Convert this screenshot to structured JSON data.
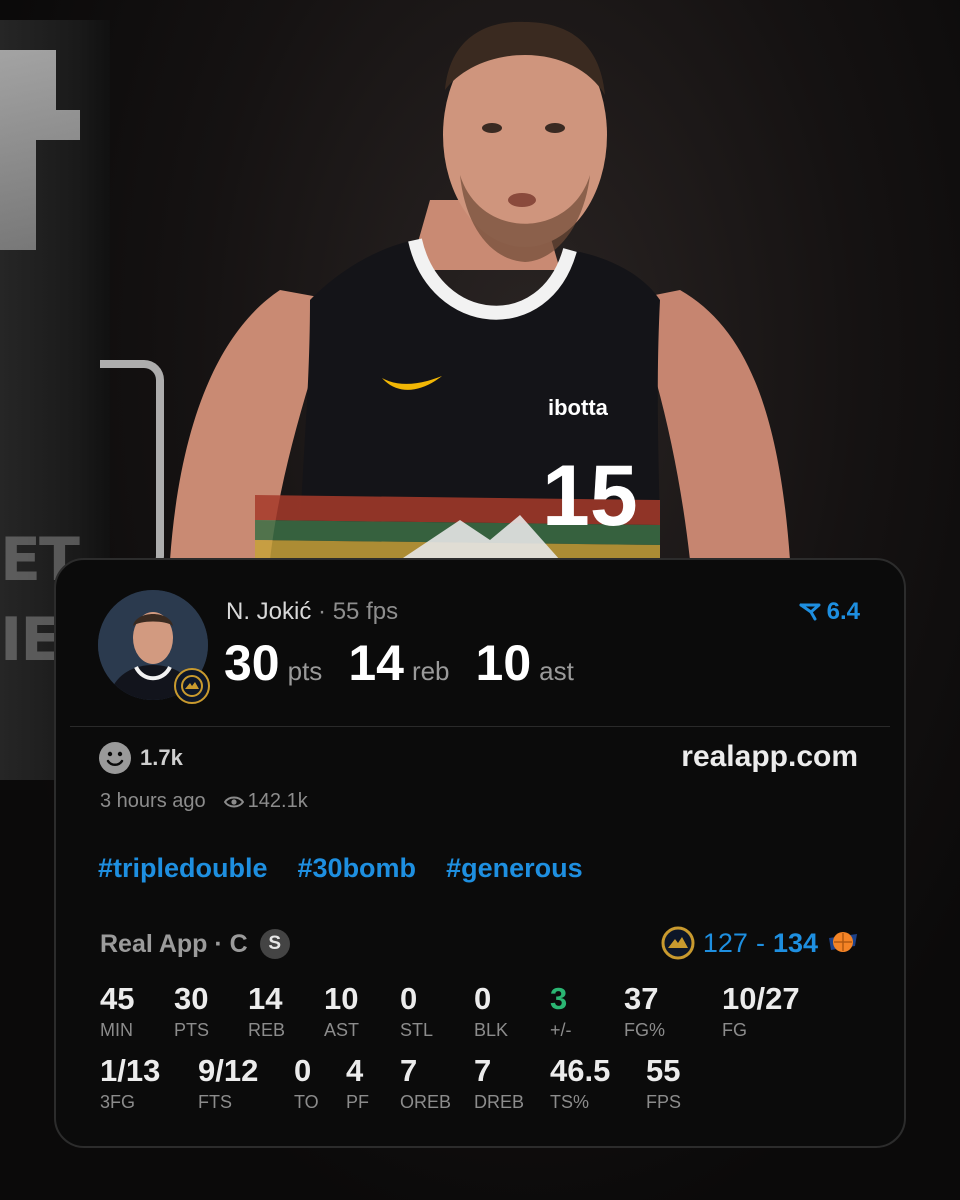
{
  "player": {
    "name": "N. Jokić",
    "separator": "·",
    "fps": "55 fps",
    "rating": "6.4",
    "headline": [
      {
        "value": "30",
        "unit": "pts"
      },
      {
        "value": "14",
        "unit": "reb"
      },
      {
        "value": "10",
        "unit": "ast"
      }
    ],
    "jersey_brand": "ibotta",
    "jersey_number": "15"
  },
  "post": {
    "reactions": "1.7k",
    "site": "realapp.com",
    "time_ago": "3 hours ago",
    "views": "142.1k",
    "tags": [
      "#tripledouble",
      "#30bomb",
      "#generous"
    ]
  },
  "game": {
    "source": "Real App · C",
    "source_badge": "S",
    "score_home": "127",
    "score_dash": "-",
    "score_away": "134"
  },
  "stats_row1": [
    {
      "value": "45",
      "label": "MIN"
    },
    {
      "value": "30",
      "label": "PTS"
    },
    {
      "value": "14",
      "label": "REB"
    },
    {
      "value": "10",
      "label": "AST"
    },
    {
      "value": "0",
      "label": "STL"
    },
    {
      "value": "0",
      "label": "BLK"
    },
    {
      "value": "3",
      "label": "+/-"
    },
    {
      "value": "37",
      "label": "FG%"
    },
    {
      "value": "10/27",
      "label": "FG"
    }
  ],
  "stats_row2": [
    {
      "value": "1/13",
      "label": "3FG"
    },
    {
      "value": "9/12",
      "label": "FTS"
    },
    {
      "value": "0",
      "label": "TO"
    },
    {
      "value": "4",
      "label": "PF"
    },
    {
      "value": "7",
      "label": "OREB"
    },
    {
      "value": "7",
      "label": "DREB"
    },
    {
      "value": "46.5",
      "label": "TS%"
    },
    {
      "value": "55",
      "label": "FPS"
    }
  ],
  "colors": {
    "accent_blue": "#1e8fe0",
    "plus_minus_green": "#2bb673",
    "card_bg": "#0b0b0b"
  },
  "icons": [
    "smiley-icon",
    "eye-icon",
    "nuggets-logo-icon",
    "knicks-logo-icon",
    "rating-arrow-icon"
  ]
}
